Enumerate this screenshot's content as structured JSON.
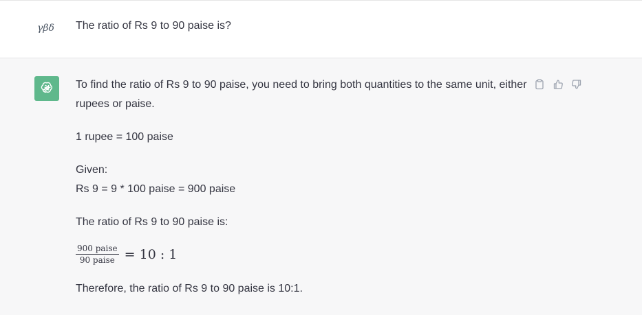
{
  "user": {
    "avatar_text": "γβδ",
    "message": "The ratio of Rs 9 to 90 paise is?"
  },
  "assistant": {
    "avatar_icon": "openai-logo-icon",
    "lines": {
      "l1": "To find the ratio of Rs 9 to 90 paise, you need to bring both quantities to the same unit, either",
      "l2": "rupees or paise.",
      "l3": "1 rupee = 100 paise",
      "l4": "Given:",
      "l5": "Rs 9 = 9 * 100 paise = 900 paise",
      "l6": "The ratio of Rs 9 to 90 paise is:",
      "l7": "Therefore, the ratio of Rs 9 to 90 paise is 10:1."
    },
    "formula": {
      "numerator": "900 paise",
      "denominator": "90 paise",
      "result": "= 10 : 1"
    },
    "actions": {
      "copy_icon": "clipboard-icon",
      "like_icon": "thumbs-up-icon",
      "dislike_icon": "thumbs-down-icon"
    }
  },
  "colors": {
    "avatar_bg": "#5fb88c",
    "assistant_bg": "#f7f7f8",
    "text": "#343541"
  }
}
